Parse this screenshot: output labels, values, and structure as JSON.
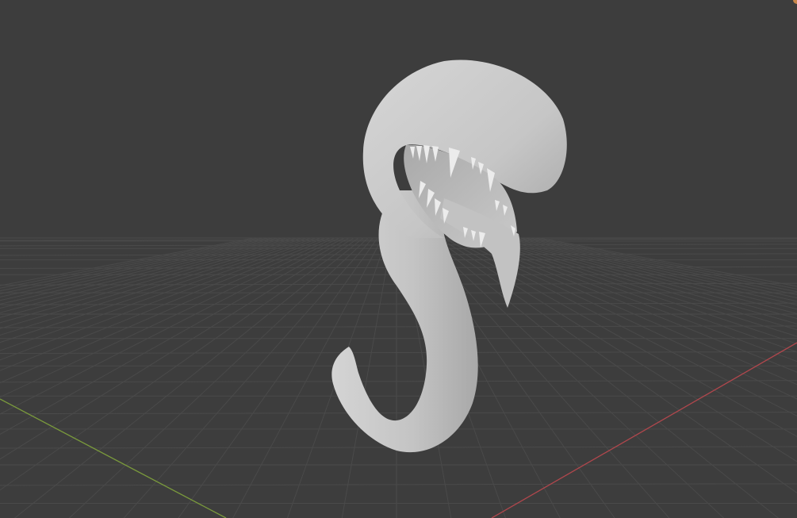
{
  "viewport": {
    "background_color": "#3d3d3d",
    "grid_color": "#4a4a4a",
    "grid_minor_color": "#444444",
    "x_axis_color": "#b0474d",
    "y_axis_color": "#7a9a3c",
    "mesh_color": "#c8c8c8",
    "mesh_shadow_color": "#9a9a9a",
    "teeth_color": "#ececec",
    "mouth_inner_color": "#b5b5b5"
  },
  "scene": {
    "object_icon": "tentacle-creature-mesh",
    "corner_icon": "gizmo-corner-icon"
  }
}
